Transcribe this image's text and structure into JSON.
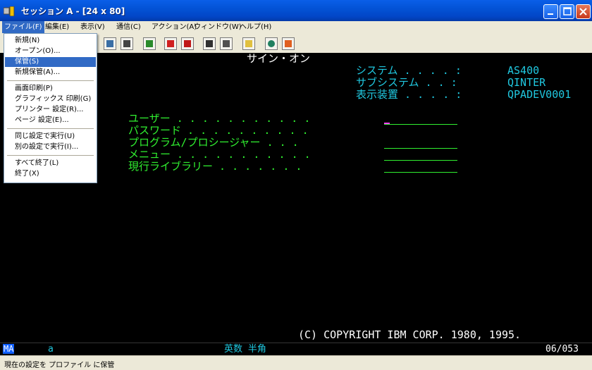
{
  "window": {
    "title": "セッション A - [24 x 80]"
  },
  "menubar": [
    {
      "label": "ファイル(F)"
    },
    {
      "label": "編集(E)"
    },
    {
      "label": "表示(V)"
    },
    {
      "label": "通信(C)"
    },
    {
      "label": "アクション(A)"
    },
    {
      "label": "ウィンドウ(W)"
    },
    {
      "label": "ヘルプ(H)"
    }
  ],
  "file_menu": [
    {
      "label": "新規(N)"
    },
    {
      "label": "オープン(O)..."
    },
    {
      "label": "保管(S)"
    },
    {
      "label": "新規保管(A)..."
    },
    {
      "label": "画面印刷(P)"
    },
    {
      "label": "グラフィックス 印刷(G)"
    },
    {
      "label": "プリンター 設定(R)..."
    },
    {
      "label": "ページ 設定(E)..."
    },
    {
      "label": "同じ設定で実行(U)"
    },
    {
      "label": "別の設定で実行(I)..."
    },
    {
      "label": "すべて終了(L)"
    },
    {
      "label": "終了(X)"
    }
  ],
  "toolbar_icons": [
    "copy-icon",
    "paste-icon",
    "screen-icon",
    "send-icon",
    "receive-icon",
    "macro-record-icon",
    "macro-play-icon",
    "display-icon",
    "web-icon",
    "edit-icon"
  ],
  "terminal": {
    "title": "サイン・オン",
    "system_label": "システム . . . . :",
    "system_value": "AS400",
    "subsystem_label": "サブシステム . . :",
    "subsystem_value": "QINTER",
    "device_label": "表示装置 . . . . :",
    "device_value": "QPADEV0001",
    "fields": [
      {
        "label": "ユーザー . . . . . . . . . . ."
      },
      {
        "label": "パスワード . . . . . . . . . ."
      },
      {
        "label": "プログラム/プロシージャー . . ."
      },
      {
        "label": "メニュー . . . . . . . . . . ."
      },
      {
        "label": "現行ライブラリー . . . . . . ."
      }
    ],
    "copyright": "(C) COPYRIGHT IBM CORP. 1980, 1995."
  },
  "oia": {
    "indicator": "MA",
    "session": "a",
    "input_mode": "英数 半角",
    "cursor_pos": "06/053"
  },
  "status": {
    "text": "現在の設定を プロファイル に保管"
  },
  "colors": {
    "term_bg": "#000000",
    "green": "#30f030",
    "cyan": "#20c8e0",
    "white": "#ffffff",
    "highlight": "#316ac5",
    "titlebar": "#0353d6"
  }
}
